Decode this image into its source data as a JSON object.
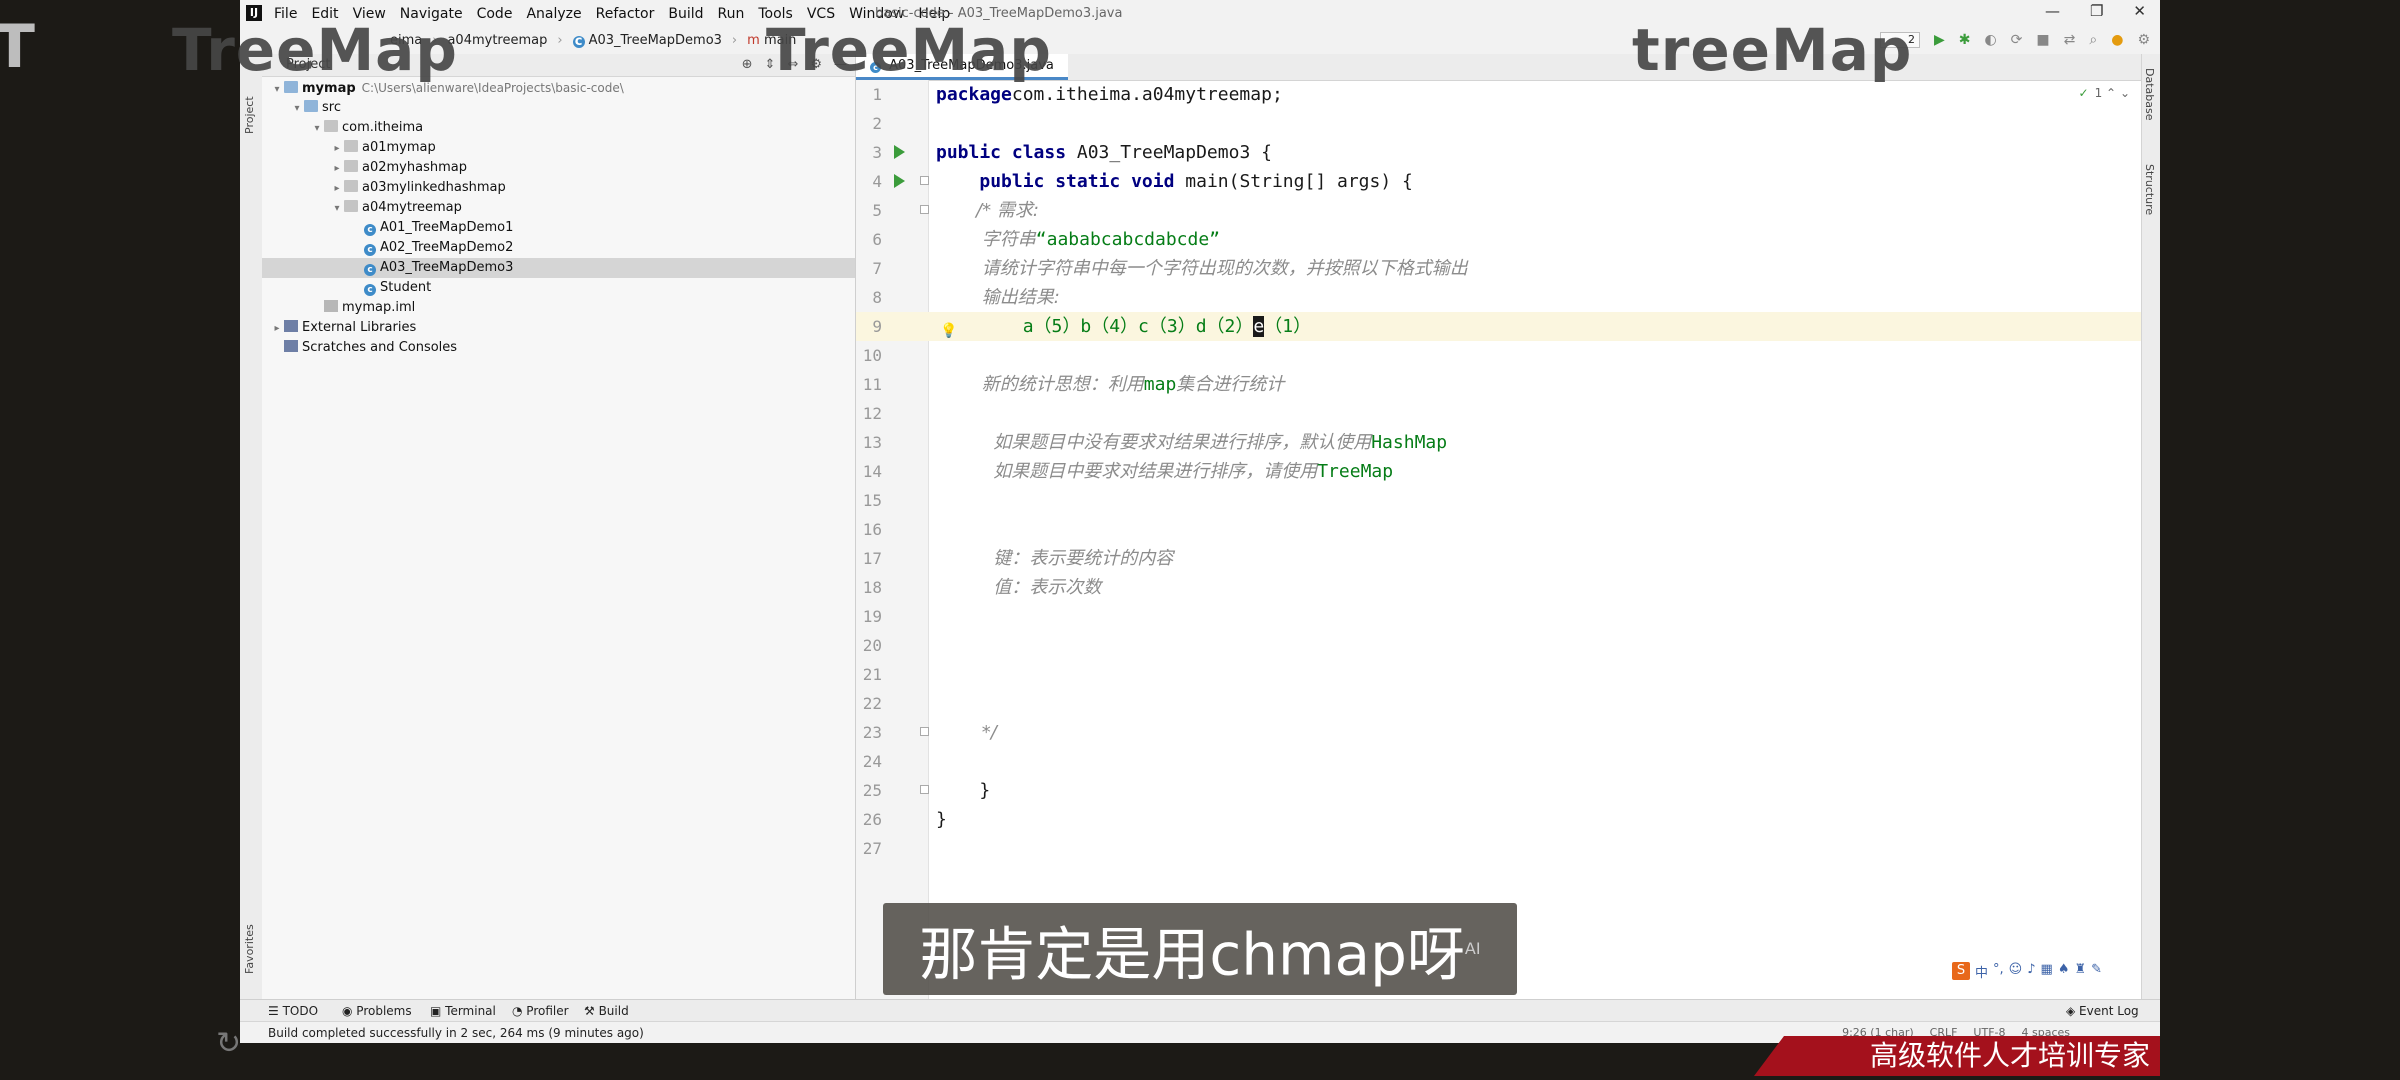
{
  "overlay": {
    "left_glyph": "Т",
    "watermarks": [
      "TreeMap",
      "TreeMap",
      "treeMap"
    ],
    "subtitle": "那肯定是用chmap呀",
    "subtitle_ai": "AI",
    "banner": "高级软件人才培训专家",
    "ime_logo": "S",
    "ime_lang": "中"
  },
  "app": {
    "logo": "IJ",
    "menu": [
      "File",
      "Edit",
      "View",
      "Navigate",
      "Code",
      "Analyze",
      "Refactor",
      "Build",
      "Run",
      "Tools",
      "VCS",
      "Window",
      "Help"
    ],
    "window_title": "basic-code - A03_TreeMapDemo3.java",
    "window_controls": [
      "—",
      "❐",
      "✕"
    ]
  },
  "breadcrumbs": [
    "eima",
    "a04mytreemap",
    "A03_TreeMapDemo3",
    "main"
  ],
  "run_config": "2",
  "project": {
    "title": "Project",
    "tree": [
      {
        "label": "mymap",
        "path": "C:\\Users\\alienware\\IdeaProjects\\basic-code\\",
        "icon": "folder",
        "depth": 0,
        "open": true,
        "bold": true
      },
      {
        "label": "src",
        "icon": "folder",
        "depth": 1,
        "open": true
      },
      {
        "label": "com.itheima",
        "icon": "pkg",
        "depth": 2,
        "open": true
      },
      {
        "label": "a01mymap",
        "icon": "pkg",
        "depth": 3,
        "open": false
      },
      {
        "label": "a02myhashmap",
        "icon": "pkg",
        "depth": 3,
        "open": false
      },
      {
        "label": "a03mylinkedhashmap",
        "icon": "pkg",
        "depth": 3,
        "open": false
      },
      {
        "label": "a04mytreemap",
        "icon": "pkg",
        "depth": 3,
        "open": true
      },
      {
        "label": "A01_TreeMapDemo1",
        "icon": "class",
        "depth": 4
      },
      {
        "label": "A02_TreeMapDemo2",
        "icon": "class",
        "depth": 4
      },
      {
        "label": "A03_TreeMapDemo3",
        "icon": "class",
        "depth": 4,
        "selected": true
      },
      {
        "label": "Student",
        "icon": "class",
        "depth": 4
      },
      {
        "label": "mymap.iml",
        "icon": "iml",
        "depth": 2
      },
      {
        "label": "External Libraries",
        "icon": "lib",
        "depth": 0,
        "open": false
      },
      {
        "label": "Scratches and Consoles",
        "icon": "lib",
        "depth": 0
      }
    ]
  },
  "editor": {
    "tab": "A03_TreeMapDemo3.java",
    "inspection": "1",
    "lines": [
      {
        "n": "1",
        "parts": [
          [
            "kw",
            "package"
          ],
          [
            "",
            "com.itheima.a04mytreemap;"
          ]
        ]
      },
      {
        "n": "2",
        "parts": []
      },
      {
        "n": "3",
        "run": true,
        "parts": [
          [
            "kw",
            "public class"
          ],
          [
            "",
            " A03_TreeMapDemo3 {"
          ]
        ]
      },
      {
        "n": "4",
        "run": true,
        "fold": true,
        "parts": [
          [
            "",
            "    "
          ],
          [
            "kw",
            "public static void"
          ],
          [
            "",
            " main(String[] args) {"
          ]
        ]
      },
      {
        "n": "5",
        "fold": true,
        "parts": [
          [
            "com",
            "       /* 需求:"
          ]
        ]
      },
      {
        "n": "6",
        "parts": [
          [
            "com",
            "        字符串"
          ],
          [
            "strg",
            "“aababcabcdabcde”"
          ]
        ]
      },
      {
        "n": "7",
        "parts": [
          [
            "com",
            "        请统计字符串中每一个字符出现的次数，并按照以下格式输出"
          ]
        ]
      },
      {
        "n": "8",
        "parts": [
          [
            "com",
            "        输出结果:"
          ]
        ]
      },
      {
        "n": "9",
        "cur": true,
        "bulb": true,
        "parts": [
          [
            "strg",
            "        a（5）b（4）c（3）d（2）"
          ],
          [
            "caret",
            "e"
          ],
          [
            "strg",
            "（1）"
          ]
        ]
      },
      {
        "n": "10",
        "parts": []
      },
      {
        "n": "11",
        "parts": [
          [
            "com",
            "        新的统计思想：利用"
          ],
          [
            "strg",
            "map"
          ],
          [
            "com",
            "集合进行统计"
          ]
        ]
      },
      {
        "n": "12",
        "parts": []
      },
      {
        "n": "13",
        "parts": [
          [
            "com",
            "          如果题目中没有要求对结果进行排序，默认使用"
          ],
          [
            "strg",
            "HashMap"
          ]
        ]
      },
      {
        "n": "14",
        "parts": [
          [
            "com",
            "          如果题目中要求对结果进行排序，请使用"
          ],
          [
            "strg",
            "TreeMap"
          ]
        ]
      },
      {
        "n": "15",
        "parts": []
      },
      {
        "n": "16",
        "parts": []
      },
      {
        "n": "17",
        "parts": [
          [
            "com",
            "          键：表示要统计的内容"
          ]
        ]
      },
      {
        "n": "18",
        "parts": [
          [
            "com",
            "          值：表示次数"
          ]
        ]
      },
      {
        "n": "19",
        "parts": []
      },
      {
        "n": "20",
        "parts": []
      },
      {
        "n": "21",
        "parts": []
      },
      {
        "n": "22",
        "parts": []
      },
      {
        "n": "23",
        "fold": true,
        "parts": [
          [
            "com",
            "        */"
          ]
        ]
      },
      {
        "n": "24",
        "parts": []
      },
      {
        "n": "25",
        "fold": true,
        "parts": [
          [
            "",
            "    }"
          ]
        ]
      },
      {
        "n": "26",
        "parts": [
          [
            "",
            "}"
          ]
        ]
      },
      {
        "n": "27",
        "parts": []
      }
    ]
  },
  "side_tools": {
    "left": [
      "Project",
      "Favorites"
    ],
    "right": [
      "Database",
      "Structure"
    ]
  },
  "bottom_tabs": [
    "TODO",
    "Problems",
    "Terminal",
    "Profiler",
    "Build"
  ],
  "event_log": "Event Log",
  "status": {
    "message": "Build completed successfully in 2 sec, 264 ms (9 minutes ago)",
    "position": "9:26 (1 char)",
    "line_sep": "CRLF",
    "encoding": "UTF-8",
    "indent": "4 spaces"
  }
}
